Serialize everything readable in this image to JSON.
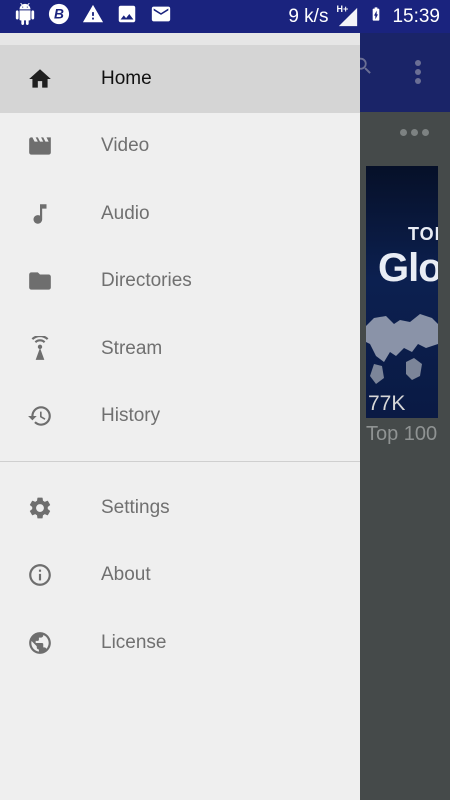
{
  "status_bar": {
    "speed": "9 k/s",
    "network": "H+",
    "time": "15:39",
    "icons": [
      "android-icon",
      "b-icon",
      "warning-icon",
      "image-icon",
      "email-icon",
      "signal-icon",
      "battery-charging-icon"
    ]
  },
  "drawer": {
    "primary_items": [
      {
        "label": "Home",
        "icon": "home-icon",
        "active": true
      },
      {
        "label": "Video",
        "icon": "clapperboard-icon",
        "active": false
      },
      {
        "label": "Audio",
        "icon": "music-note-icon",
        "active": false
      },
      {
        "label": "Directories",
        "icon": "folder-icon",
        "active": false
      },
      {
        "label": "Stream",
        "icon": "antenna-icon",
        "active": false
      },
      {
        "label": "History",
        "icon": "history-icon",
        "active": false
      }
    ],
    "secondary_items": [
      {
        "label": "Settings",
        "icon": "gear-icon"
      },
      {
        "label": "About",
        "icon": "info-icon"
      },
      {
        "label": "License",
        "icon": "globe-icon"
      }
    ]
  },
  "background": {
    "thumb_text_top": "TOP",
    "thumb_text_big": "Glo",
    "thumb_count": "77K",
    "caption": "Top 100"
  },
  "colors": {
    "status_bar": "#1a237e",
    "drawer_bg": "#efefef",
    "active_row": "#d5d5d5",
    "scrim": "#454a4a"
  }
}
